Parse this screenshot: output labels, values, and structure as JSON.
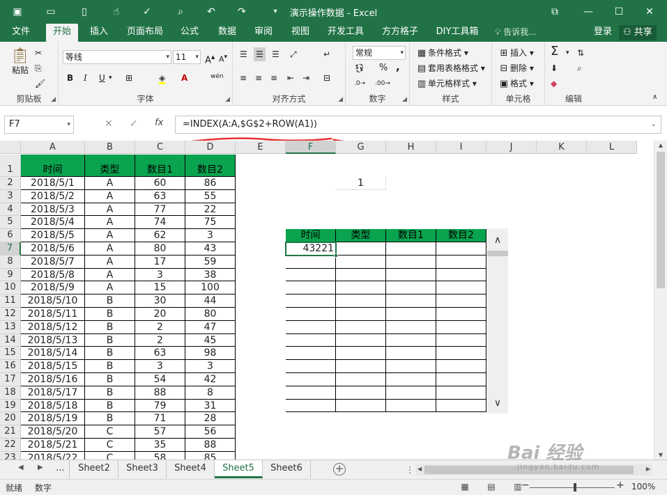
{
  "titlebar": {
    "title": "演示操作数据 - Excel",
    "icons": [
      "save-icon",
      "open-icon",
      "new-icon",
      "touch-icon",
      "spellcheck-icon",
      "preview-icon",
      "undo-icon",
      "redo-icon",
      "customize-icon"
    ],
    "undo": "↶",
    "redo": "↷",
    "restore": "⧉",
    "min": "—",
    "max": "☐",
    "close": "✕"
  },
  "tabs": {
    "items": [
      "文件",
      "开始",
      "插入",
      "页面布局",
      "公式",
      "数据",
      "审阅",
      "视图",
      "开发工具",
      "方方格子",
      "DIY工具箱"
    ],
    "active": "开始",
    "tell_me": "告诉我...",
    "login": "登录",
    "share": "共享"
  },
  "ribbon": {
    "clipboard": {
      "label": "剪贴板",
      "paste": "粘贴"
    },
    "font": {
      "label": "字体",
      "name": "等线",
      "size": "11",
      "bold": "B",
      "italic": "I",
      "underline": "U",
      "wen": "wén"
    },
    "alignment": {
      "label": "对齐方式"
    },
    "number": {
      "label": "数字",
      "format": "常规",
      "percent": "%",
      "comma": ","
    },
    "styles": {
      "label": "样式",
      "cond": "条件格式",
      "table": "套用表格格式",
      "cell": "单元格样式"
    },
    "cells": {
      "label": "单元格",
      "insert": "插入",
      "delete": "删除",
      "format": "格式"
    },
    "editing": {
      "label": "编辑",
      "sum": "Σ"
    }
  },
  "formula_bar": {
    "name_box": "F7",
    "fx": "fx",
    "formula": "=INDEX(A:A,$G$2+ROW(A1))",
    "cancel": "✕",
    "enter": "✓"
  },
  "grid": {
    "columns": [
      "A",
      "B",
      "C",
      "D",
      "E",
      "F",
      "G",
      "H",
      "I",
      "J",
      "K",
      "L"
    ],
    "selected_column": "F",
    "rows": [
      "1",
      "2",
      "3",
      "4",
      "5",
      "6",
      "7",
      "8",
      "9",
      "10",
      "11",
      "12",
      "13",
      "14",
      "15",
      "16",
      "17",
      "18",
      "19",
      "20",
      "21",
      "22",
      "23"
    ],
    "selected_row": "7",
    "headers": [
      "时间",
      "类型",
      "数目1",
      "数目2"
    ],
    "data": [
      [
        "2018/5/1",
        "A",
        "60",
        "86"
      ],
      [
        "2018/5/2",
        "A",
        "63",
        "55"
      ],
      [
        "2018/5/3",
        "A",
        "77",
        "22"
      ],
      [
        "2018/5/4",
        "A",
        "74",
        "75"
      ],
      [
        "2018/5/5",
        "A",
        "62",
        "3"
      ],
      [
        "2018/5/6",
        "A",
        "80",
        "43"
      ],
      [
        "2018/5/7",
        "A",
        "17",
        "59"
      ],
      [
        "2018/5/8",
        "A",
        "3",
        "38"
      ],
      [
        "2018/5/9",
        "A",
        "15",
        "100"
      ],
      [
        "2018/5/10",
        "B",
        "30",
        "44"
      ],
      [
        "2018/5/11",
        "B",
        "20",
        "80"
      ],
      [
        "2018/5/12",
        "B",
        "2",
        "47"
      ],
      [
        "2018/5/13",
        "B",
        "2",
        "45"
      ],
      [
        "2018/5/14",
        "B",
        "63",
        "98"
      ],
      [
        "2018/5/15",
        "B",
        "3",
        "3"
      ],
      [
        "2018/5/16",
        "B",
        "54",
        "42"
      ],
      [
        "2018/5/17",
        "B",
        "88",
        "8"
      ],
      [
        "2018/5/18",
        "B",
        "79",
        "31"
      ],
      [
        "2018/5/19",
        "B",
        "71",
        "28"
      ],
      [
        "2018/5/20",
        "C",
        "57",
        "56"
      ],
      [
        "2018/5/21",
        "C",
        "35",
        "88"
      ],
      [
        "2018/5/22",
        "C",
        "58",
        "85"
      ]
    ],
    "g2_value": "1",
    "right_headers": [
      "时间",
      "类型",
      "数目1",
      "数目2"
    ],
    "f7_value": "43221",
    "scroll_up": "∧",
    "scroll_down": "∨"
  },
  "sheets": {
    "more": "...",
    "items": [
      "Sheet2",
      "Sheet3",
      "Sheet4",
      "Sheet5",
      "Sheet6"
    ],
    "active": "Sheet5",
    "add": "+"
  },
  "status": {
    "ready": "就绪",
    "mode": "数字",
    "zoom": "100%",
    "minus": "−",
    "plus": "+"
  },
  "watermark": {
    "main": "Bai 经验",
    "sub": "jingyan.baidu.com"
  },
  "colors": {
    "excel_green": "#217346",
    "header_fill": "#0aa34f",
    "annotation_red": "#e8322f"
  }
}
